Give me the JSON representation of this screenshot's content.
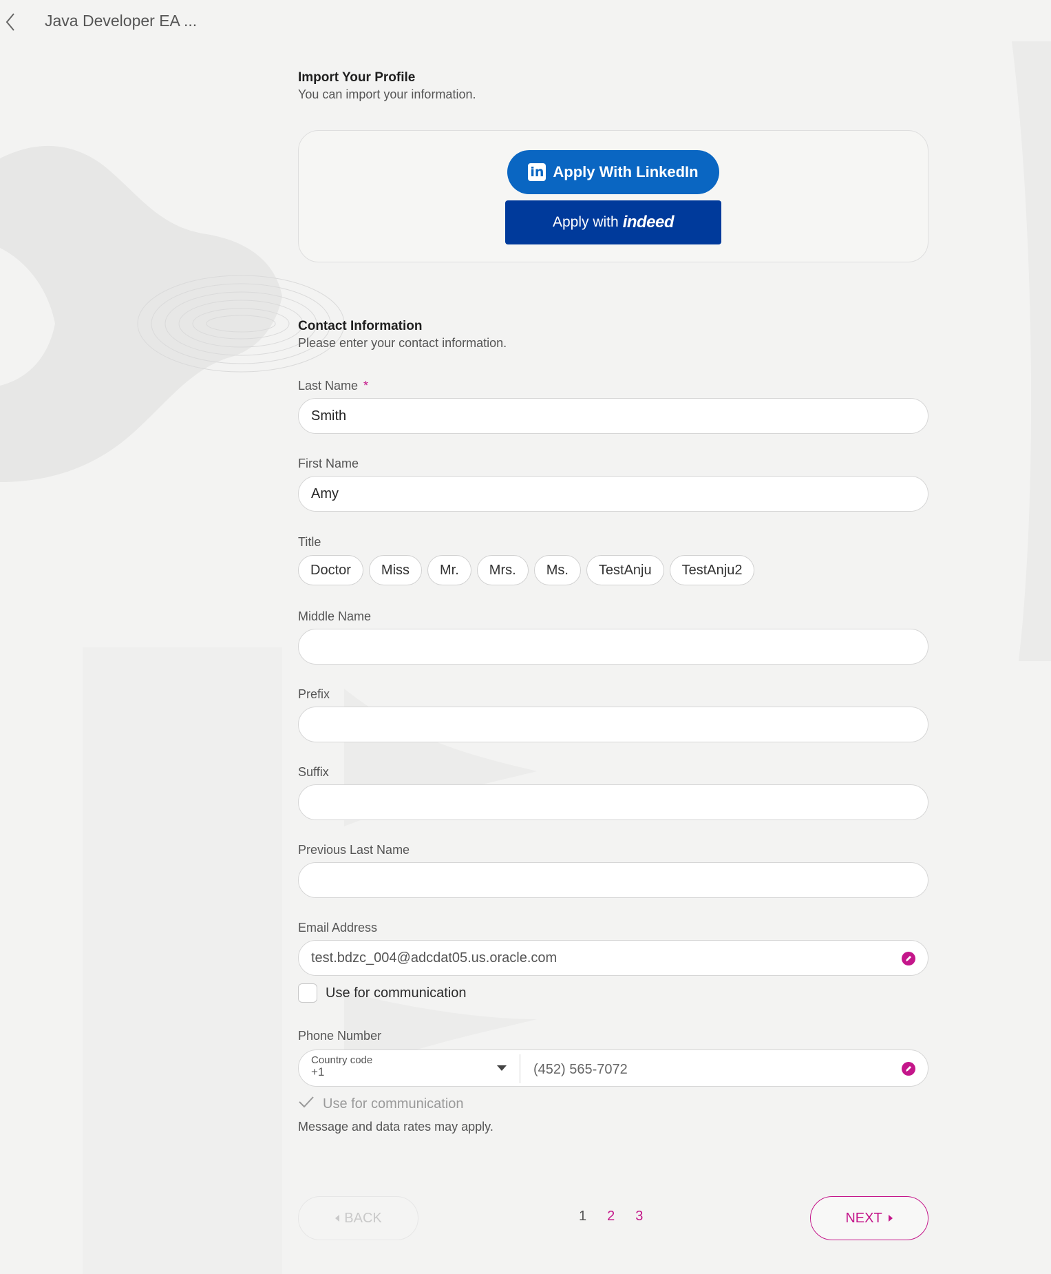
{
  "header": {
    "job_title": "Java Developer EA ..."
  },
  "import_profile": {
    "title": "Import Your Profile",
    "subtitle": "You can import your information.",
    "linkedin_logo": "in",
    "linkedin_label": "Apply With LinkedIn",
    "indeed_prefix": "Apply with",
    "indeed_logo": "indeed"
  },
  "contact": {
    "title": "Contact Information",
    "subtitle": "Please enter your contact information.",
    "last_name": {
      "label": "Last Name",
      "required_mark": "*",
      "value": "Smith"
    },
    "first_name": {
      "label": "First Name",
      "value": "Amy"
    },
    "title_field": {
      "label": "Title",
      "options": [
        "Doctor",
        "Miss",
        "Mr.",
        "Mrs.",
        "Ms.",
        "TestAnju",
        "TestAnju2"
      ]
    },
    "middle_name": {
      "label": "Middle Name",
      "value": ""
    },
    "prefix": {
      "label": "Prefix",
      "value": ""
    },
    "suffix": {
      "label": "Suffix",
      "value": ""
    },
    "previous_last_name": {
      "label": "Previous Last Name",
      "value": ""
    },
    "email": {
      "label": "Email Address",
      "value": "test.bdzc_004@adcdat05.us.oracle.com",
      "use_for_communication": "Use for communication"
    },
    "phone": {
      "label": "Phone Number",
      "country_code_label": "Country code",
      "country_code_value": "+1",
      "value": "(452) 565-7072",
      "use_for_communication": "Use for communication",
      "note": "Message and data rates may apply."
    }
  },
  "footer": {
    "back_label": "BACK",
    "next_label": "NEXT",
    "pages": [
      "1",
      "2",
      "3"
    ]
  },
  "colors": {
    "accent": "#c4168a",
    "linkedin": "#0a66c2",
    "indeed": "#003a9b"
  }
}
